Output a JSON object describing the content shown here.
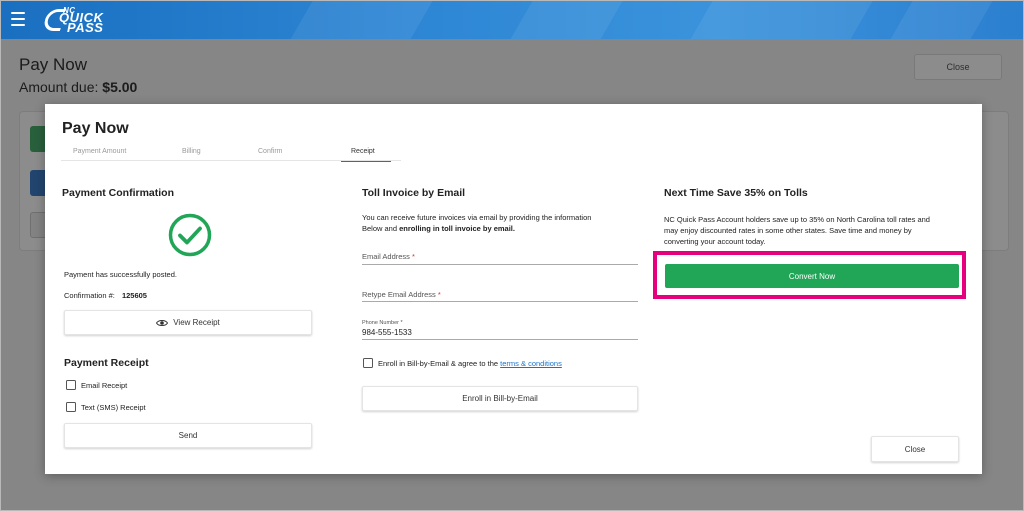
{
  "header": {
    "menu_icon": "hamburger-menu-icon",
    "logo": {
      "small": "NC",
      "line1": "QUICK",
      "line2": "PASS"
    }
  },
  "page": {
    "title": "Pay Now",
    "amount_label": "Amount due:",
    "amount_value": "$5.00",
    "close_label": "Close"
  },
  "modal": {
    "title": "Pay Now",
    "tabs": [
      {
        "label": "Payment Amount"
      },
      {
        "label": "Billing"
      },
      {
        "label": "Confirm"
      },
      {
        "label": "Receipt"
      }
    ],
    "active_tab": "Receipt",
    "confirmation": {
      "heading": "Payment Confirmation",
      "success_icon": "check-circle-icon",
      "success_color": "#21a557",
      "message": "Payment has successfully posted.",
      "number_label": "Confirmation #:",
      "number_value": "125605",
      "view_receipt_label": "View Receipt",
      "view_icon": "eye-icon"
    },
    "receipt": {
      "heading": "Payment Receipt",
      "email_option": "Email Receipt",
      "sms_option": "Text (SMS) Receipt",
      "send_label": "Send"
    },
    "toll_invoice": {
      "heading": "Toll Invoice by Email",
      "desc_line1": "You can receive future invoices via email by providing the information",
      "desc_line2_a": "Below and ",
      "desc_line2_b": "enrolling in toll invoice by email.",
      "email_label": "Email Address",
      "retype_email_label": "Retype Email Address",
      "required_mark": "*",
      "phone_label": "Phone Number",
      "phone_value": "984-555-1533",
      "enroll_check_text": "Enroll in Bill-by-Email & agree to the",
      "terms_link": "terms & conditions",
      "enroll_button": "Enroll in Bill-by-Email"
    },
    "save": {
      "heading": "Next Time Save 35% on Tolls",
      "desc_line1": "NC Quick Pass Account holders save up to 35% on North Carolina toll rates and",
      "desc_line2": "may enjoy discounted rates in some other states. Save time and money by",
      "desc_line3": "converting your account today.",
      "convert_label": "Convert Now",
      "highlight_color": "#e6007e",
      "button_color": "#21a557"
    },
    "close_label": "Close"
  }
}
